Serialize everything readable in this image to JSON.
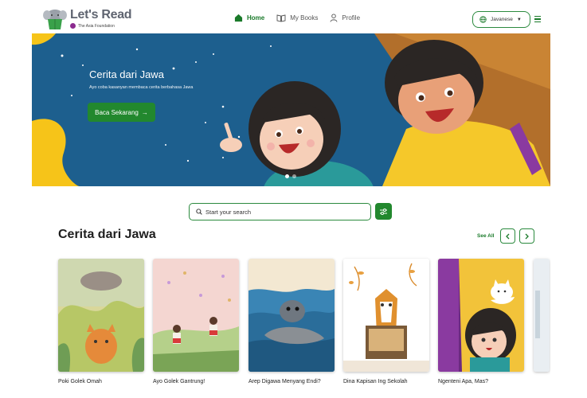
{
  "header": {
    "logo_title": "Let's Read",
    "logo_sub": "The Asia Foundation",
    "nav": [
      {
        "label": "Home",
        "icon": "home-icon",
        "active": true
      },
      {
        "label": "My Books",
        "icon": "book-icon",
        "active": false
      },
      {
        "label": "Profile",
        "icon": "user-icon",
        "active": false
      }
    ],
    "language": "Javanese"
  },
  "hero": {
    "title": "Cerita dari Jawa",
    "subtitle": "Ayo coba kasanyan membaca cerita berbahasa Jawa",
    "button": "Baca Sekarang",
    "slides": 2,
    "active_slide": 1
  },
  "search": {
    "placeholder": "Start your search"
  },
  "section": {
    "title": "Cerita dari Jawa",
    "see_all": "See All",
    "books": [
      {
        "title": "Poki Golek Omah"
      },
      {
        "title": "Ayo Golek Gantrung!"
      },
      {
        "title": "Arep Digawa Menyang Endi?"
      },
      {
        "title": "Dina Kapisan Ing Sekolah"
      },
      {
        "title": "Ngenteni Apa, Mas?"
      }
    ]
  },
  "colors": {
    "brand_green": "#22882e",
    "hero_blue": "#1d5f8e",
    "hero_yellow": "#f6c419"
  }
}
